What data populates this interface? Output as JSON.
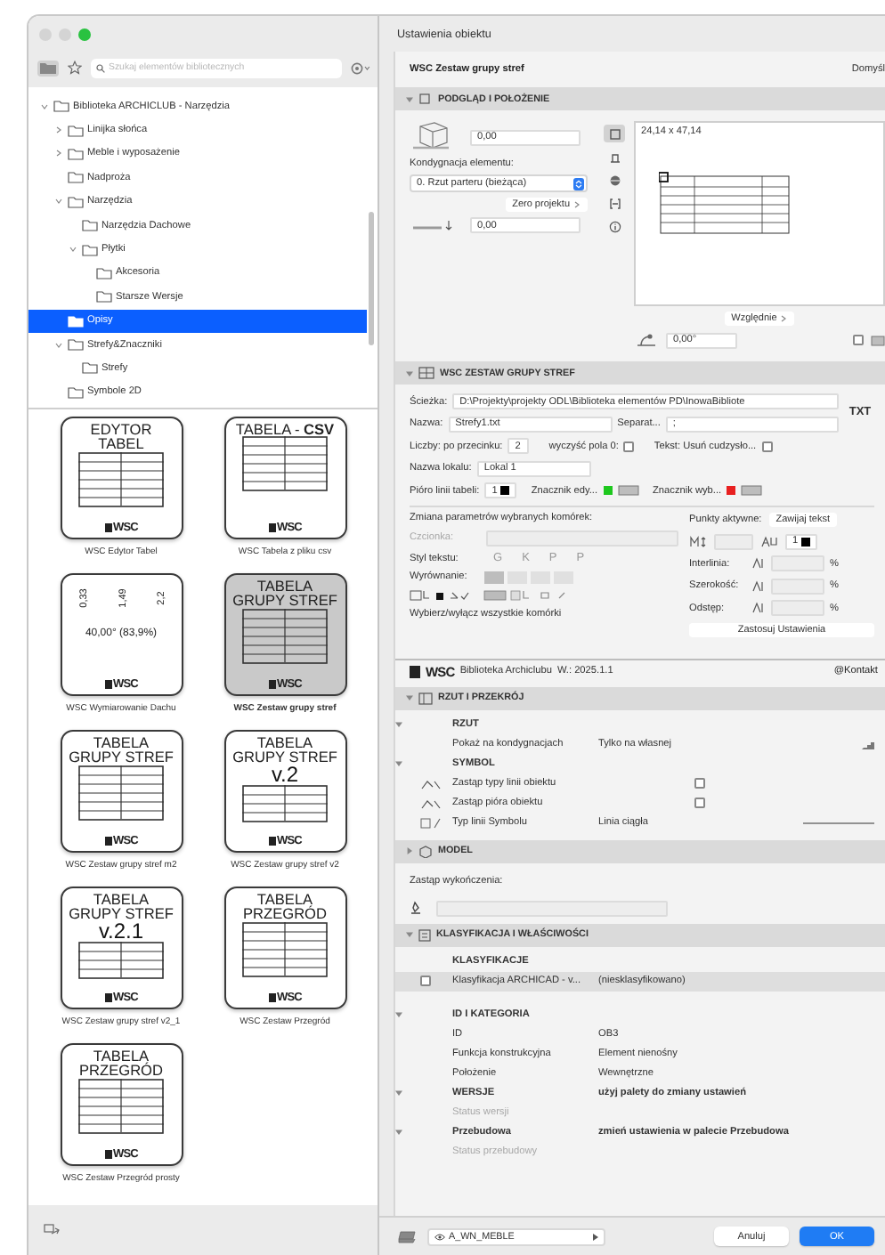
{
  "window": {
    "title": "Ustawienia obiektu"
  },
  "library": {
    "search": {
      "placeholder": "Szukaj elementów bibliotecznych"
    },
    "tree": [
      {
        "label": "Biblioteka ARCHICLUB - Narzędzia",
        "expanded": true,
        "selected": false,
        "children": [
          {
            "label": "Linijka słońca",
            "expanded": false,
            "selected": false
          },
          {
            "label": "Meble i wyposażenie",
            "expanded": false,
            "selected": false
          },
          {
            "label": "Nadproża",
            "selected": false
          },
          {
            "label": "Narzędzia",
            "expanded": true,
            "selected": false,
            "children": [
              {
                "label": "Narzędzia Dachowe",
                "selected": false
              },
              {
                "label": "Płytki",
                "expanded": true,
                "selected": false,
                "children": [
                  {
                    "label": "Akcesoria",
                    "selected": false
                  },
                  {
                    "label": "Starsze Wersje",
                    "selected": false
                  }
                ]
              }
            ]
          },
          {
            "label": "Opisy",
            "selected": true
          },
          {
            "label": "Strefy&Znaczniki",
            "expanded": true,
            "selected": false,
            "children": [
              {
                "label": "Strefy",
                "selected": false
              }
            ]
          },
          {
            "label": "Symbole 2D",
            "selected": false
          }
        ]
      }
    ],
    "items": [
      {
        "kind": "table",
        "title": [
          "EDYTOR",
          "TABEL"
        ],
        "logo": "WSC",
        "caption": "WSC Edytor Tabel",
        "selected": false
      },
      {
        "kind": "table",
        "title": [
          "TABELA - **CSV**"
        ],
        "logo": "WSC",
        "caption": "WSC Tabela z pliku csv",
        "selected": false
      },
      {
        "kind": "dimension",
        "dims": [
          "0,33",
          "1,49",
          "2,2"
        ],
        "angle": "40,00° (83,9%)",
        "logo": "WSC",
        "caption": "WSC Wymiarowanie Dachu",
        "selected": false
      },
      {
        "kind": "table",
        "title": [
          "TABELA",
          "GRUPY STREF"
        ],
        "logo": "WSC",
        "caption": "WSC Zestaw grupy stref",
        "selected": true
      },
      {
        "kind": "table",
        "title": [
          "TABELA",
          "GRUPY STREF"
        ],
        "logo": "WSC",
        "caption": "WSC Zestaw grupy stref m2",
        "selected": false
      },
      {
        "kind": "table",
        "title": [
          "TABELA",
          "GRUPY STREF"
        ],
        "version": "v.2",
        "logo": "WSC",
        "caption": "WSC Zestaw grupy stref v2",
        "selected": false
      },
      {
        "kind": "table",
        "title": [
          "TABELA",
          "GRUPY STREF"
        ],
        "version": "v.2.1",
        "logo": "WSC",
        "caption": "WSC Zestaw grupy stref v2_1",
        "selected": false
      },
      {
        "kind": "table",
        "title": [
          "TABELA",
          "PRZEGRÓD"
        ],
        "logo": "WSC",
        "caption": "WSC Zestaw Przegród",
        "selected": false
      },
      {
        "kind": "table",
        "title": [
          "TABELA",
          "PRZEGRÓD"
        ],
        "logo": "WSC",
        "caption": "WSC Zestaw Przegród prosty",
        "selected": false
      }
    ]
  },
  "object": {
    "name": "WSC Zestaw grupy stref",
    "defaults": "Domyśl"
  },
  "preview_section": {
    "title": "PODGLĄD I POŁOŻENIE",
    "expanded": true,
    "elevation": "0,00",
    "story_label": "Kondygnacja elementu:",
    "story": "0. Rzut parteru (bieżąca)",
    "reference": "Zero projektu",
    "base": "0,00",
    "views": [
      {
        "kind": "plan",
        "selected": true
      },
      {
        "kind": "section",
        "selected": false
      },
      {
        "kind": "model",
        "selected": false
      },
      {
        "kind": "dimension",
        "selected": false
      },
      {
        "kind": "info",
        "selected": false
      }
    ],
    "size": "24,14 x 47,14",
    "relative": "Względnie",
    "angle": "0,00°",
    "mirrored": false
  },
  "params_section": {
    "title": "WSC ZESTAW GRUPY STREF",
    "expanded": true,
    "path_label": "Ścieżka:",
    "path": "D:\\Projekty\\projekty ODL\\Biblioteka elementów PD\\InowaBibliote",
    "badge": "TXT",
    "name_label": "Nazwa:",
    "name": "Strefy1.txt",
    "separator_label": "Separat...",
    "separator": ";",
    "decimals_label": "Liczby: po przecinku:",
    "decimals": "2",
    "clear_zero_label": "wyczyść pola 0:",
    "clear_zero": false,
    "quotes_label": "Tekst: Usuń cudzysło...",
    "remove_quotes": false,
    "locale_label": "Nazwa lokalu:",
    "locale": "Lokal 1",
    "pen_label": "Pióro linii tabeli:",
    "pen": "1",
    "markers": [
      {
        "label": "Znacznik edy...",
        "color": "#1ec81e"
      },
      {
        "label": "Znacznik wyb...",
        "color": "#e82020"
      }
    ],
    "change_label": "Zmiana parametrów wybranych komórek:",
    "hotspots_label": "Punkty aktywne:",
    "wrap": "Zawijaj tekst",
    "font_label": "Czcionka:",
    "text_pen": "1",
    "style_label": "Styl tekstu:",
    "styles": [
      "G",
      "K",
      "P",
      "P"
    ],
    "align_label": "Wyrównanie:",
    "metrics": [
      {
        "label": "Interlinia:",
        "unit": "%"
      },
      {
        "label": "Szerokość:",
        "unit": "%"
      },
      {
        "label": "Odstęp:",
        "unit": "%"
      }
    ],
    "select_all": "Wybierz/wyłącz wszystkie komórki",
    "apply": "Zastosuj Ustawienia"
  },
  "library_bar": {
    "logo": "WSC",
    "name": "Biblioteka Archiclubu",
    "version": "W.: 2025.1.1",
    "contact": "@Kontakt"
  },
  "plan_section": {
    "title": "RZUT I PRZEKRÓJ",
    "expanded": true,
    "rows": [
      {
        "kind": "group",
        "label": "RZUT",
        "expanded": true
      },
      {
        "kind": "choice",
        "label": "Pokaż na kondygnacjach",
        "value": "Tylko na własnej"
      },
      {
        "kind": "group",
        "label": "SYMBOL",
        "expanded": true
      },
      {
        "kind": "check",
        "label": "Zastąp typy linii obiektu",
        "checked": false
      },
      {
        "kind": "check",
        "label": "Zastąp pióra obiektu",
        "checked": false
      },
      {
        "kind": "linetype",
        "label": "Typ linii Symbolu",
        "value": "Linia ciągła"
      }
    ]
  },
  "model_section": {
    "title": "MODEL",
    "expanded": false,
    "override_label": "Zastąp wykończenia:"
  },
  "class_section": {
    "title": "KLASYFIKACJA I WŁAŚCIWOŚCI",
    "expanded": true,
    "rows": [
      {
        "kind": "header",
        "label": "KLASYFIKACJE"
      },
      {
        "kind": "class",
        "label": "Klasyfikacja ARCHICAD - v...",
        "value": "(niesklasyfikowano)",
        "checked": false
      },
      {
        "kind": "group",
        "label": "ID I KATEGORIA",
        "expanded": true
      },
      {
        "kind": "value",
        "label": "ID",
        "value": "OB3",
        "disabled": false
      },
      {
        "kind": "value",
        "label": "Funkcja konstrukcyjna",
        "value": "Element nienośny",
        "disabled": false
      },
      {
        "kind": "value",
        "label": "Położenie",
        "value": "Wewnętrzne",
        "disabled": false
      },
      {
        "kind": "group",
        "label": "WERSJE",
        "value": "użyj palety do zmiany ustawień",
        "expanded": true
      },
      {
        "kind": "value",
        "label": "Status wersji",
        "disabled": true
      },
      {
        "kind": "group",
        "label": "Przebudowa",
        "value": "zmień ustawienia w palecie Przebudowa",
        "expanded": true
      },
      {
        "kind": "value",
        "label": "Status przebudowy",
        "disabled": true
      }
    ]
  },
  "footer": {
    "layer": "A_WN_MEBLE",
    "cancel": "Anuluj",
    "ok": "OK"
  }
}
